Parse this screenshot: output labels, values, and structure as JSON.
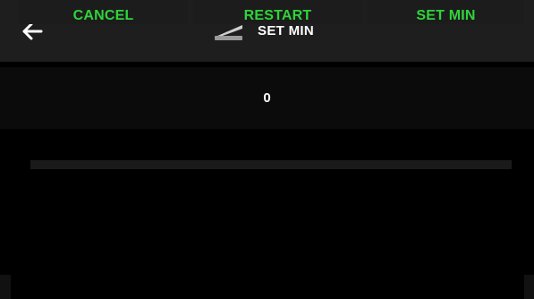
{
  "header": {
    "title": "SET MIN",
    "back_icon": "arrow-left-icon",
    "title_icon": "pedal-icon"
  },
  "value": {
    "text": "0"
  },
  "slider": {
    "level_fraction": 0
  },
  "footer": {
    "buttons": [
      {
        "label": "CANCEL"
      },
      {
        "label": "RESTART"
      },
      {
        "label": "SET MIN"
      }
    ]
  },
  "colors": {
    "accent": "#2fd43a",
    "header_bg": "#1e1e1e",
    "panel_bg": "#0b0b0b",
    "button_bg": "#1c1c1c",
    "track_bg": "#1a1a1a",
    "background": "#000000"
  }
}
